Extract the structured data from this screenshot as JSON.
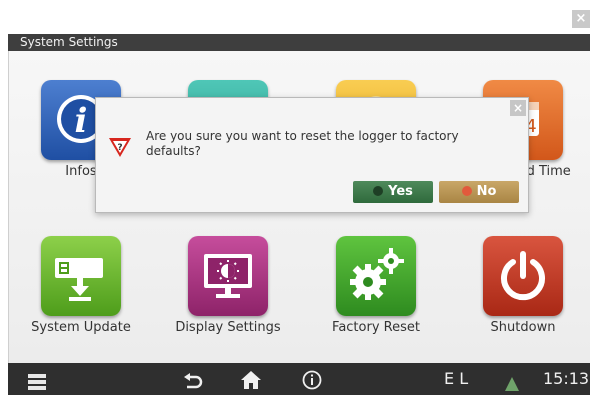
{
  "window": {
    "title": "System Settings",
    "close_glyph": "×"
  },
  "tiles": [
    {
      "label": "Infos",
      "icon": "info-icon",
      "color": "#2a5bb0"
    },
    {
      "label": "",
      "icon": "teal-tile-icon",
      "color": "#35a898"
    },
    {
      "label": "",
      "icon": "yellow-tile-icon",
      "color": "#eeb22f"
    },
    {
      "label": "Date and Time",
      "icon": "calendar-icon",
      "color": "#e06a2a"
    },
    {
      "label": "System Update",
      "icon": "update-icon",
      "color": "#62ad2a"
    },
    {
      "label": "Display Settings",
      "icon": "display-icon",
      "color": "#a8307f"
    },
    {
      "label": "Factory Reset",
      "icon": "gears-icon",
      "color": "#3b9c2a"
    },
    {
      "label": "Shutdown",
      "icon": "power-icon",
      "color": "#bf3a24"
    }
  ],
  "dialog": {
    "message": "Are you sure you want to reset the logger to factory defaults?",
    "close_glyph": "×",
    "yes_label": "Yes",
    "no_label": "No",
    "icon": "warning-question-icon"
  },
  "bottom_bar": {
    "menu_icon": "menu-icon",
    "back_icon": "back-icon",
    "home_icon": "home-icon",
    "info_icon": "info-circle-icon",
    "status_text": "E L",
    "alert_icon": "warning-triangle-icon",
    "time": "15:13"
  }
}
